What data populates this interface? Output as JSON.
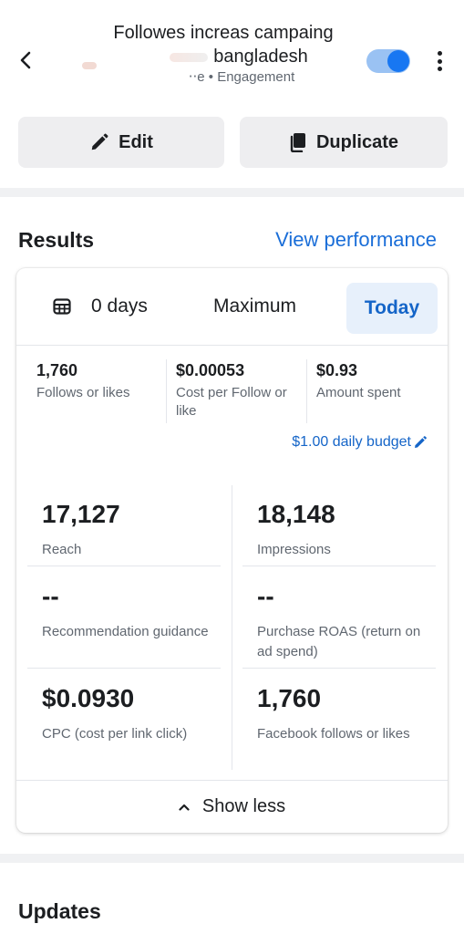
{
  "header": {
    "title_line1": "Followes increas campaing",
    "title_line2": "bangladesh",
    "subtitle_status": "‧‧e",
    "subtitle_objective": "Engagement",
    "toggle_on": true
  },
  "actions": {
    "edit_label": "Edit",
    "duplicate_label": "Duplicate"
  },
  "results": {
    "title": "Results",
    "view_performance": "View performance",
    "range": {
      "days_label": "0 days",
      "maximum_label": "Maximum",
      "today_label": "Today",
      "selected": "Today"
    },
    "summary": [
      {
        "value": "1,760",
        "label": "Follows or likes"
      },
      {
        "value": "$0.00053",
        "label": "Cost per Follow or like"
      },
      {
        "value": "$0.93",
        "label": "Amount spent"
      }
    ],
    "budget_label": "$1.00 daily budget",
    "metrics": [
      {
        "value": "17,127",
        "label": "Reach"
      },
      {
        "value": "18,148",
        "label": "Impressions"
      },
      {
        "value": "--",
        "label": "Recommendation guidance"
      },
      {
        "value": "--",
        "label": "Purchase ROAS (return on ad spend)"
      },
      {
        "value": "$0.0930",
        "label": "CPC (cost per link click)"
      },
      {
        "value": "1,760",
        "label": "Facebook follows or likes"
      }
    ],
    "show_less_label": "Show less"
  },
  "updates": {
    "title": "Updates"
  },
  "colors": {
    "accent": "#1877f2",
    "link": "#1a6ed8",
    "today_bg": "#e7f0fb",
    "button_bg": "#eeeef0",
    "separator": "#f0f1f3"
  },
  "icons": [
    "back-arrow-icon",
    "more-vertical-icon",
    "pencil-icon",
    "duplicate-icon",
    "calendar-icon",
    "chevron-up-icon"
  ]
}
